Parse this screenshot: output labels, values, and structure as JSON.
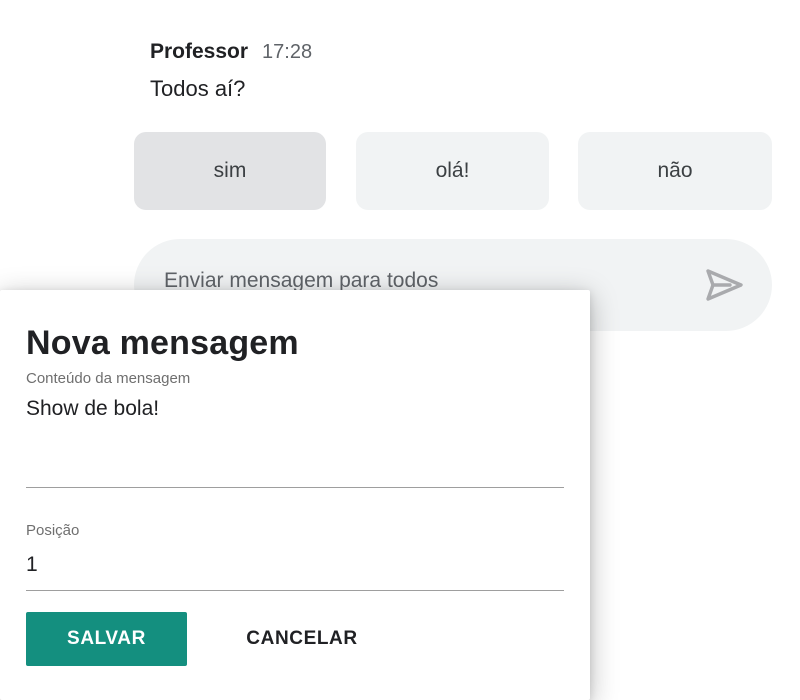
{
  "message": {
    "author": "Professor",
    "time": "17:28",
    "text": "Todos aí?"
  },
  "quick_replies": [
    {
      "label": "sim",
      "selected": true
    },
    {
      "label": "olá!",
      "selected": false
    },
    {
      "label": "não",
      "selected": false
    }
  ],
  "composer": {
    "placeholder": "Enviar mensagem para todos",
    "send_icon": "send-icon"
  },
  "dialog": {
    "title": "Nova mensagem",
    "content_label": "Conteúdo da mensagem",
    "content_value": "Show de bola!",
    "position_label": "Posição",
    "position_value": "1",
    "save_label": "SALVAR",
    "cancel_label": "CANCELAR"
  },
  "colors": {
    "accent": "#148f7f",
    "chip_bg": "#f1f3f4",
    "chip_selected_bg": "#e2e3e5"
  }
}
